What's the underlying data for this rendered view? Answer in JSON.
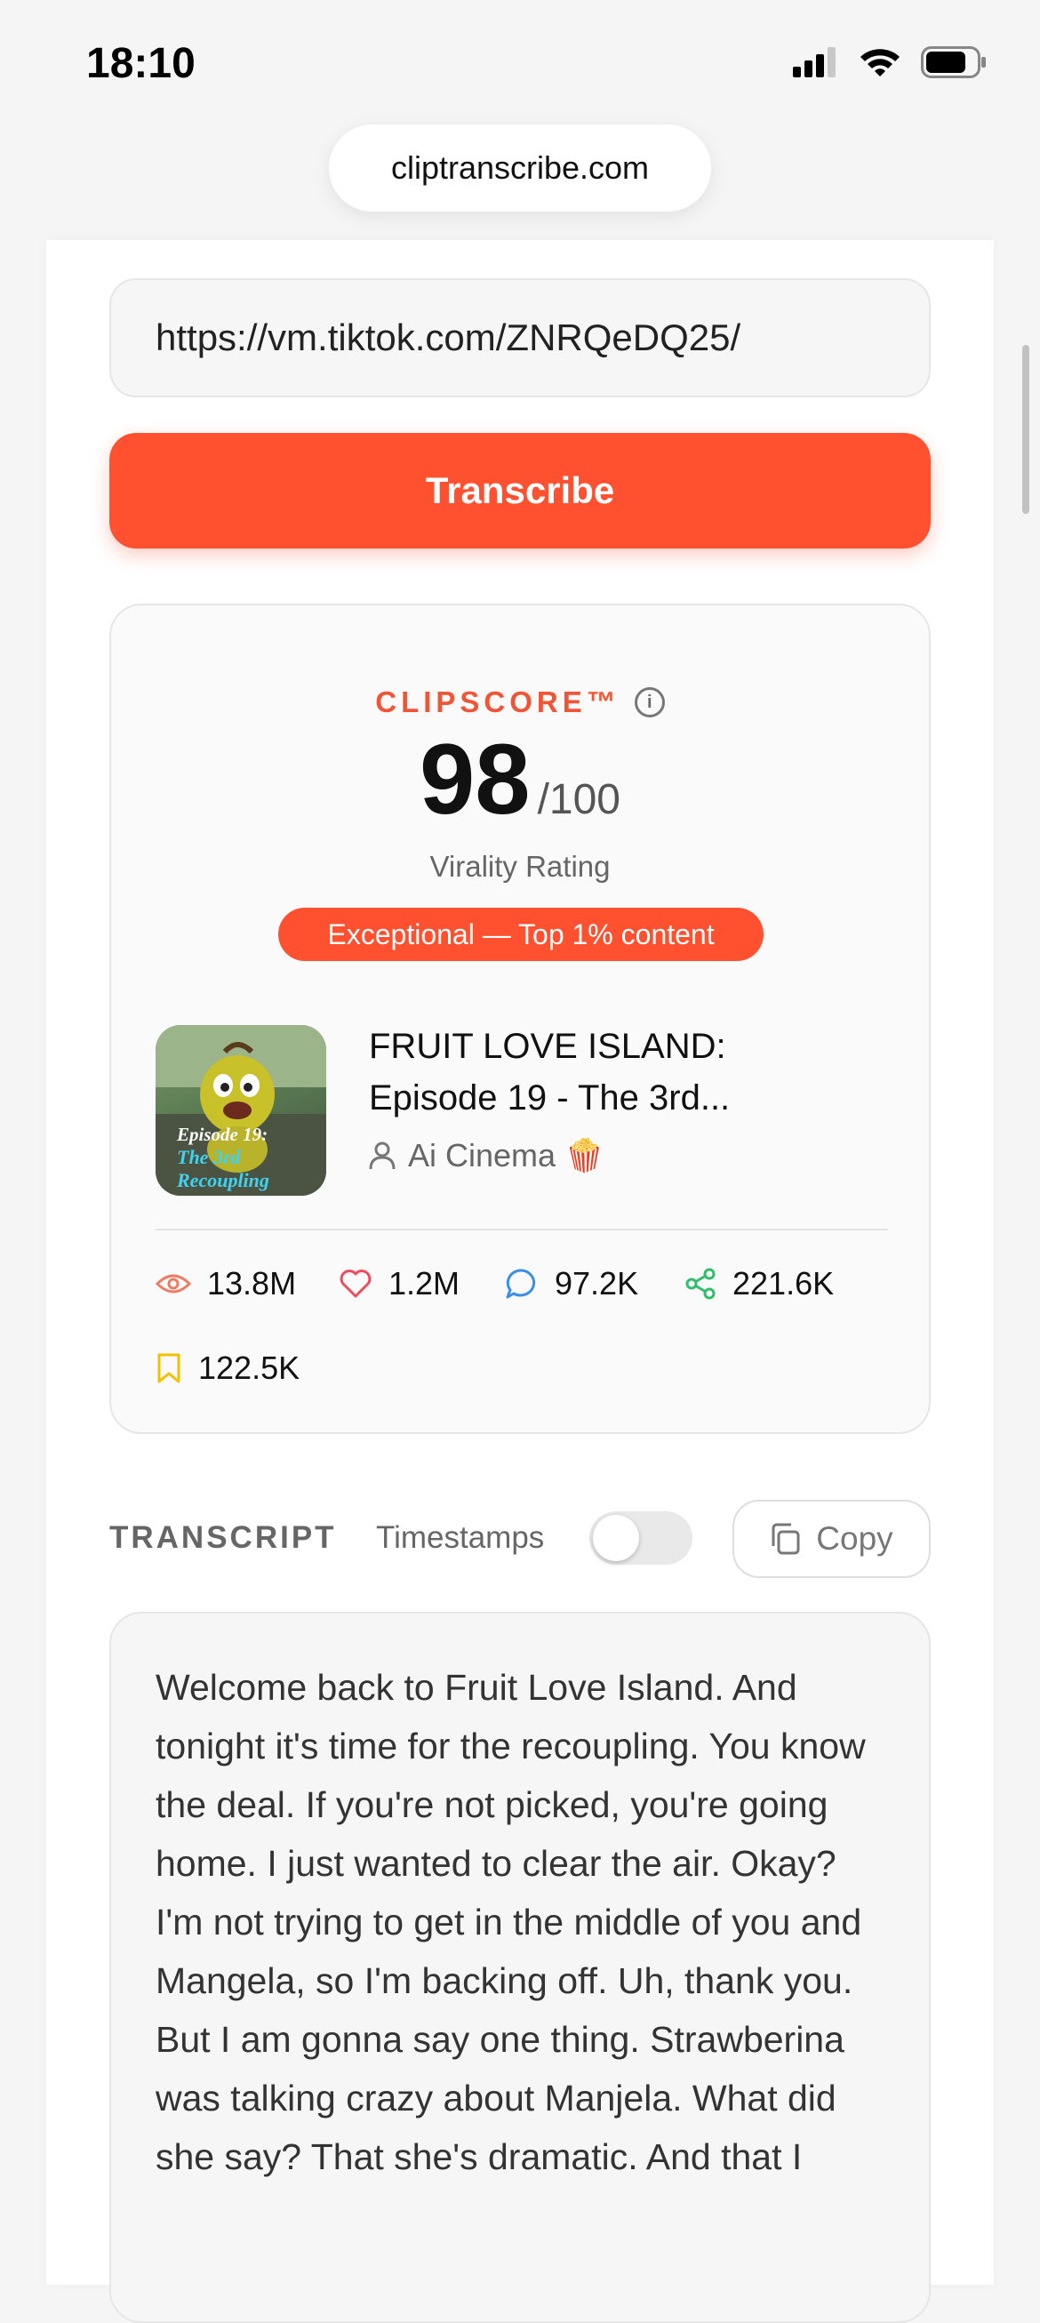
{
  "status_bar": {
    "time": "18:10"
  },
  "browser": {
    "url": "cliptranscribe.com"
  },
  "form": {
    "link_value": "https://vm.tiktok.com/ZNRQeDQ25/",
    "transcribe_label": "Transcribe"
  },
  "score_card": {
    "label": "CLIPSCORE™",
    "score": "98",
    "max": "/100",
    "rating_label": "Virality Rating",
    "badge": "Exceptional — Top 1% content",
    "video": {
      "title_line1": "FRUIT LOVE ISLAND:",
      "title_line2": "Episode 19 - The 3rd...",
      "author": "Ai Cinema 🍿",
      "thumbnail_text_line1": "Episode 19:",
      "thumbnail_text_line2": "The 3rd",
      "thumbnail_text_line3": "Recoupling"
    },
    "stats": {
      "views": "13.8M",
      "likes": "1.2M",
      "comments": "97.2K",
      "shares": "221.6K",
      "saves": "122.5K"
    }
  },
  "transcript": {
    "heading": "TRANSCRIPT",
    "timestamps_label": "Timestamps",
    "timestamps_enabled": false,
    "copy_label": "Copy",
    "text": "Welcome back to Fruit Love Island. And tonight it's time for the recoupling. You know the deal. If you're not picked, you're going home. I just wanted to clear the air. Okay? I'm not trying to get in the middle of you and Mangela, so I'm backing off. Uh, thank you. But I am gonna say one thing. Strawberina was talking crazy about Manjela. What did she say? That she's dramatic. And that I"
  },
  "colors": {
    "accent": "#ff502f",
    "views_icon": "#f07b64",
    "likes_icon": "#ef4b5c",
    "comments_icon": "#3b8fe8",
    "shares_icon": "#2fbf6a",
    "saves_icon": "#f2c200"
  },
  "icons": [
    "signal-icon",
    "wifi-icon",
    "battery-icon",
    "info-icon",
    "user-icon",
    "eye-icon",
    "heart-icon",
    "comment-icon",
    "share-icon",
    "bookmark-icon",
    "copy-icon"
  ]
}
